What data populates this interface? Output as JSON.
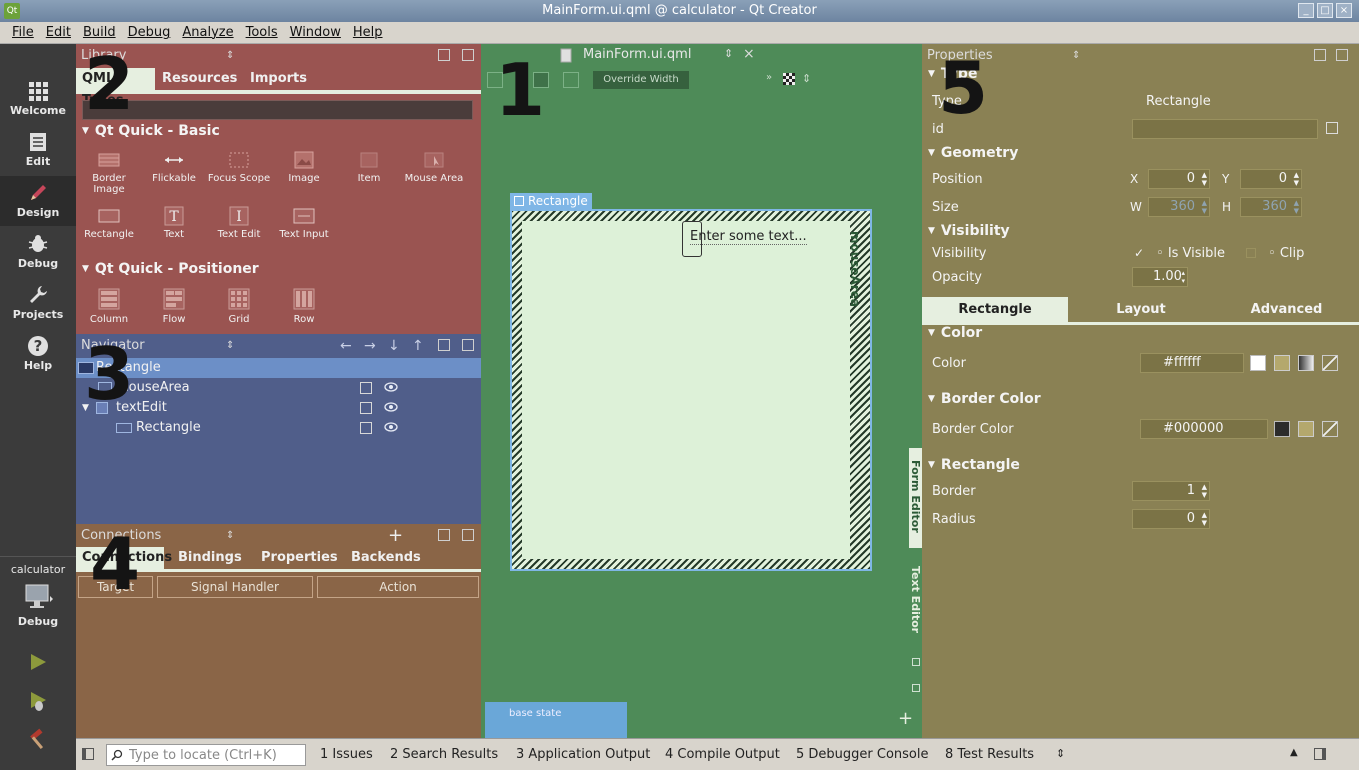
{
  "window": {
    "title": "MainForm.ui.qml @ calculator - Qt Creator",
    "app_icon": "Qt"
  },
  "menu": [
    "File",
    "Edit",
    "Build",
    "Debug",
    "Analyze",
    "Tools",
    "Window",
    "Help"
  ],
  "modes": [
    {
      "label": "Welcome",
      "icon": "grid-icon"
    },
    {
      "label": "Edit",
      "icon": "document-icon"
    },
    {
      "label": "Design",
      "icon": "pencil-icon"
    },
    {
      "label": "Debug",
      "icon": "bug-icon"
    },
    {
      "label": "Projects",
      "icon": "wrench-icon"
    },
    {
      "label": "Help",
      "icon": "help-icon"
    }
  ],
  "kit": {
    "project": "calculator",
    "mode": "Debug"
  },
  "annotations": [
    "1",
    "2",
    "3",
    "4",
    "5"
  ],
  "library": {
    "title": "Library",
    "tabs": [
      "QML Types",
      "Resources",
      "Imports"
    ],
    "search_value": "",
    "sections": [
      {
        "title": "Qt Quick - Basic",
        "items": [
          "Border Image",
          "Flickable",
          "Focus Scope",
          "Image",
          "Item",
          "Mouse Area",
          "Rectangle",
          "Text",
          "Text Edit",
          "Text Input"
        ]
      },
      {
        "title": "Qt Quick - Positioner",
        "items": [
          "Column",
          "Flow",
          "Grid",
          "Row"
        ]
      }
    ]
  },
  "navigator": {
    "title": "Navigator",
    "rows": [
      {
        "label": "Rectangle",
        "level": 0
      },
      {
        "label": "mouseArea",
        "level": 1
      },
      {
        "label": "textEdit",
        "level": 1
      },
      {
        "label": "Rectangle",
        "level": 2
      }
    ]
  },
  "connections": {
    "title": "Connections",
    "tabs": [
      "Connections",
      "Bindings",
      "Properties",
      "Backends"
    ],
    "columns": [
      "Target",
      "Signal Handler",
      "Action"
    ]
  },
  "editor": {
    "file_tab": "MainForm.ui.qml",
    "override_label": "Override Width",
    "canvas_label": "Rectangle",
    "text_item": "Enter some text...",
    "mouse_area_label": "mouseArea",
    "side_tabs": [
      "Form Editor",
      "Text Editor"
    ],
    "state": "base state"
  },
  "properties": {
    "title": "Properties",
    "type_section": "Type",
    "type_label": "Type",
    "type_value": "Rectangle",
    "id_label": "id",
    "geometry": "Geometry",
    "position_label": "Position",
    "x": "0",
    "y": "0",
    "size_label": "Size",
    "w": "360",
    "h": "360",
    "visibility_section": "Visibility",
    "visibility_label": "Visibility",
    "is_visible": "Is Visible",
    "clip": "Clip",
    "opacity_label": "Opacity",
    "opacity": "1.00",
    "tabs": [
      "Rectangle",
      "Layout",
      "Advanced"
    ],
    "color_section": "Color",
    "color_label": "Color",
    "color_value": "#ffffff",
    "border_color_section": "Border Color",
    "border_color_label": "Border Color",
    "border_color_value": "#000000",
    "rect_section": "Rectangle",
    "border_label": "Border",
    "border_value": "1",
    "radius_label": "Radius",
    "radius_value": "0"
  },
  "statusbar": {
    "locate_placeholder": "Type to locate (Ctrl+K)",
    "panes": [
      "1  Issues",
      "2  Search Results",
      "3  Application Output",
      "4  Compile Output",
      "5  Debugger Console",
      "8  Test Results"
    ]
  }
}
